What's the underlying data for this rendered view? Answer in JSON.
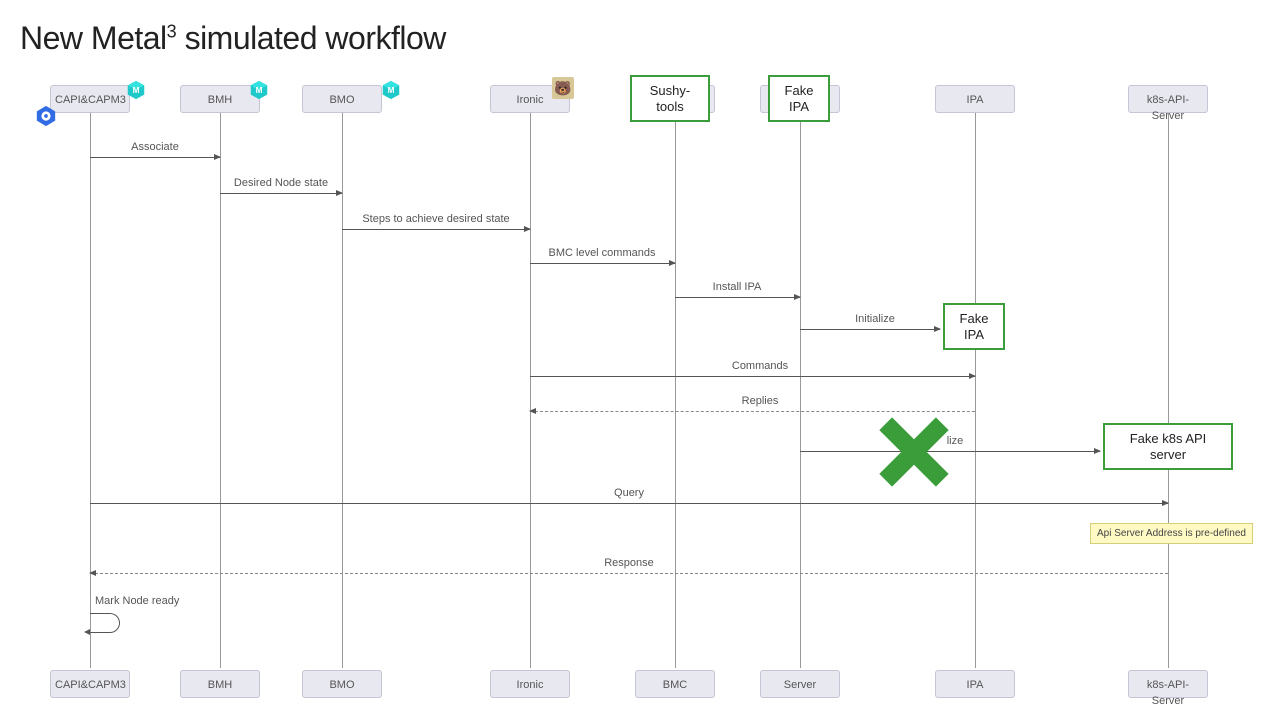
{
  "title_before": "New Metal",
  "title_sup": "3",
  "title_after": " simulated workflow",
  "participants": {
    "p1": "CAPI&CAPM3",
    "p2": "BMH",
    "p3": "BMO",
    "p4": "Ironic",
    "p5": "BMC",
    "p6": "Server",
    "p7": "IPA",
    "p8": "k8s-API-Server"
  },
  "overlays": {
    "sushy": "Sushy-\ntools",
    "fakeipa1": "Fake\nIPA",
    "fakeipa2": "Fake\nIPA",
    "fakek8s": "Fake k8s API\nserver"
  },
  "messages": {
    "m1": "Associate",
    "m2": "Desired Node state",
    "m3": "Steps to achieve desired state",
    "m4": "BMC level commands",
    "m5": "Install IPA",
    "m6": "Initialize",
    "m7": "Commands",
    "m8": "Replies",
    "m9": "lize",
    "m10": "Query",
    "m11": "Response",
    "m12": "Mark Node ready"
  },
  "note": "Api Server Address is pre-defined"
}
